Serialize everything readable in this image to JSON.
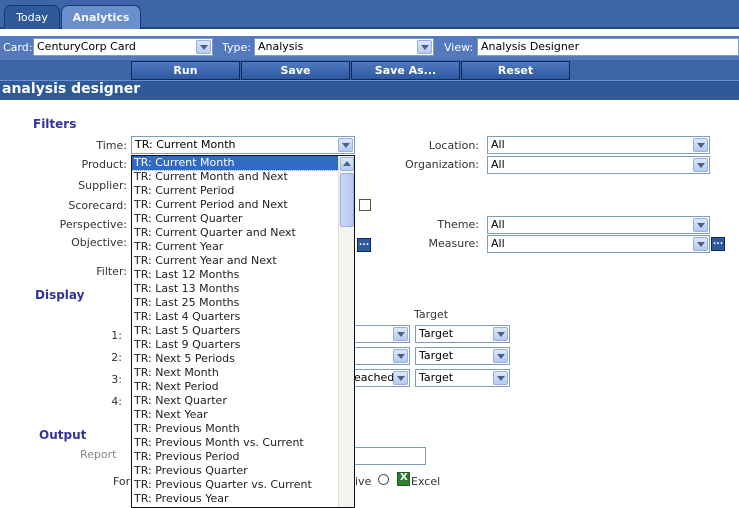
{
  "tabs": {
    "today": "Today",
    "analytics": "Analytics"
  },
  "cardbar": {
    "card_label": "Card:",
    "card_value": "CenturyCorp Card",
    "type_label": "Type:",
    "type_value": "Analysis",
    "view_label": "View:",
    "view_value": "Analysis Designer"
  },
  "actions": {
    "run": "Run",
    "save": "Save",
    "save_as": "Save As...",
    "reset": "Reset"
  },
  "page_title": "analysis designer",
  "filters": {
    "heading": "Filters",
    "time_label": "Time:",
    "time_value": "TR: Current Month",
    "product_label": "Product:",
    "supplier_label": "Supplier:",
    "scorecard_label": "Scorecard:",
    "perspective_label": "Perspective:",
    "objective_label": "Objective:",
    "filter_label": "Filter:",
    "location_label": "Location:",
    "location_value": "All",
    "organization_label": "Organization:",
    "organization_value": "All",
    "theme_label": "Theme:",
    "theme_value": "All",
    "measure_label": "Measure:",
    "measure_value": "All",
    "ellipsis": "..."
  },
  "display": {
    "heading": "Display",
    "target_header": "Target",
    "row_labels": [
      "1:",
      "2:",
      "3:",
      "4:"
    ],
    "row3_partial": "eached",
    "target_values": [
      "Target",
      "Target",
      "Target"
    ]
  },
  "output": {
    "heading": "Output",
    "report_label_partial": "Report",
    "format_label_partial": "For",
    "interactive_partial": "ive",
    "excel_label": "Excel"
  },
  "time_options": [
    "TR: Current Month",
    "TR: Current Month and Next",
    "TR: Current Period",
    "TR: Current Period and Next",
    "TR: Current Quarter",
    "TR: Current Quarter and Next",
    "TR: Current Year",
    "TR: Current Year and Next",
    "TR: Last 12 Months",
    "TR: Last 13 Months",
    "TR: Last 25 Months",
    "TR: Last 4 Quarters",
    "TR: Last 5 Quarters",
    "TR: Last 9 Quarters",
    "TR: Next 5 Periods",
    "TR: Next Month",
    "TR: Next Period",
    "TR: Next Quarter",
    "TR: Next Year",
    "TR: Previous Month",
    "TR: Previous Month vs. Current",
    "TR: Previous Period",
    "TR: Previous Quarter",
    "TR: Previous Quarter vs. Current",
    "TR: Previous Year"
  ],
  "colors": {
    "header_blue": "#3d65a8",
    "title_blue": "#2f5a99",
    "section_text": "#333399",
    "highlight": "#316ac5"
  }
}
